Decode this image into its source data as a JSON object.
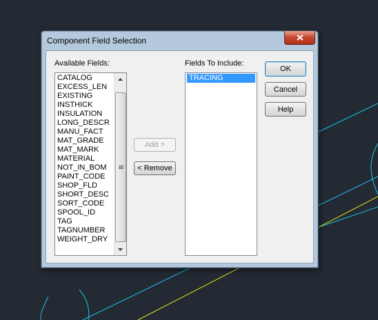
{
  "dialog": {
    "title": "Component Field Selection",
    "available_label": "Available Fields:",
    "include_label": "Fields To Include:",
    "available_fields": [
      "CATALOG",
      "EXCESS_LEN",
      "EXISTING",
      "INSTHICK",
      "INSULATION",
      "LONG_DESCR",
      "MANU_FACT",
      "MAT_GRADE",
      "MAT_MARK",
      "MATERIAL",
      "NOT_IN_BOM",
      "PAINT_CODE",
      "SHOP_FLD",
      "SHORT_DESC",
      "SORT_CODE",
      "SPOOL_ID",
      "TAG",
      "TAGNUMBER",
      "WEIGHT_DRY"
    ],
    "include_fields": [
      "TRACING"
    ],
    "buttons": {
      "ok": "OK",
      "cancel": "Cancel",
      "help": "Help",
      "add": "Add >",
      "remove": "< Remove"
    }
  },
  "colors": {
    "cad_background": "#232a33",
    "cyan_lines": "#19c8e6",
    "yellow_line": "#e6e619",
    "selection": "#3399ff"
  }
}
